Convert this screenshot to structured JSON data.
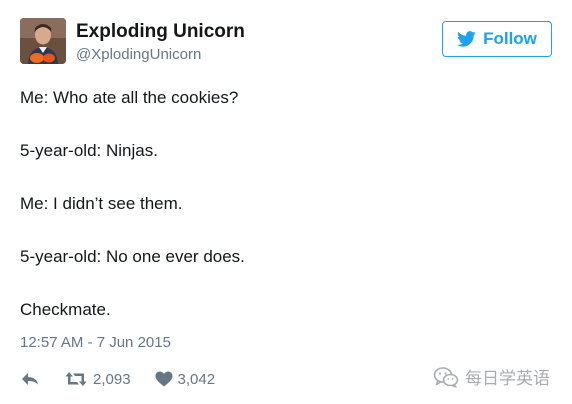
{
  "author": {
    "display_name": "Exploding Unicorn",
    "handle": "@XplodingUnicorn"
  },
  "follow_button": {
    "label": "Follow",
    "icon": "twitter-bird-icon"
  },
  "tweet": {
    "lines": [
      "Me: Who ate all the cookies?",
      "5-year-old: Ninjas.",
      "Me: I didn’t see them.",
      "5-year-old: No one ever does.",
      "Checkmate."
    ],
    "timestamp": "12:57 AM - 7 Jun 2015"
  },
  "actions": {
    "reply_icon": "reply-icon",
    "retweet_icon": "retweet-icon",
    "retweet_count": "2,093",
    "like_icon": "heart-icon",
    "like_count": "3,042"
  },
  "watermark": {
    "text": "每日学英语",
    "icon": "wechat-icon"
  },
  "colors": {
    "brand_blue": "#1da1f2",
    "text_primary": "#14171a",
    "text_secondary": "#657786",
    "watermark": "#a8adb2"
  }
}
